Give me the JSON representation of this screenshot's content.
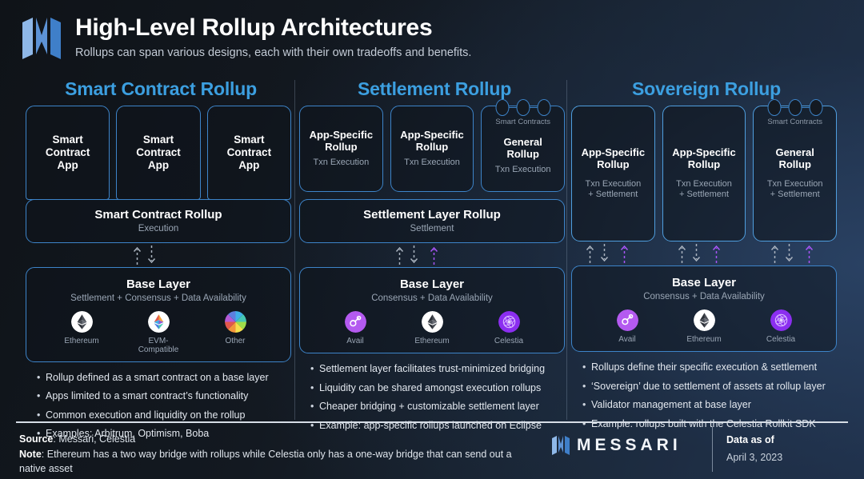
{
  "header": {
    "logo": "messari-logo",
    "title": "High-Level Rollup Architectures",
    "subtitle": "Rollups can span various designs, each with their own tradeoffs and benefits."
  },
  "colors": {
    "accent_blue": "#3c9fe0",
    "border_blue": "#3d84c9",
    "purple": "#a855f7",
    "background": "#12161c"
  },
  "columns": [
    {
      "title": "Smart Contract Rollup",
      "apps": [
        {
          "name": "Smart\nContract\nApp",
          "line1": "Smart",
          "line2": "Contract",
          "line3": "App",
          "sub": ""
        },
        {
          "name": "Smart Contract App",
          "line1": "Smart",
          "line2": "Contract",
          "line3": "App",
          "sub": ""
        },
        {
          "name": "Smart Contract App",
          "line1": "Smart",
          "line2": "Contract",
          "line3": "App",
          "sub": ""
        }
      ],
      "middle_band": {
        "title": "Smart Contract Rollup",
        "sub": "Execution"
      },
      "base_band": {
        "title": "Base Layer",
        "sub": "Settlement + Consensus + Data Availability",
        "tokens": [
          {
            "name": "Ethereum",
            "icon": "ethereum-icon"
          },
          {
            "name": "EVM-Compatible",
            "icon": "evm-compatible-icon"
          },
          {
            "name": "Other",
            "icon": "other-rainbow-icon"
          }
        ]
      },
      "bullets": [
        "Rollup defined as a smart contract on a base layer",
        "Apps limited to a smart contract’s functionality",
        "Common execution and liquidity on the rollup",
        "Examples: Arbitrum, Optimism, Boba"
      ]
    },
    {
      "title": "Settlement Rollup",
      "apps": [
        {
          "line1": "App-Specific",
          "line2": "Rollup",
          "sub": "Txn Execution",
          "bubbles": false
        },
        {
          "line1": "App-Specific",
          "line2": "Rollup",
          "sub": "Txn Execution",
          "bubbles": false
        },
        {
          "line1": "General",
          "line2": "Rollup",
          "sub": "Txn Execution",
          "bubbles": true,
          "bubble_label": "Smart Contracts"
        }
      ],
      "middle_band": {
        "title": "Settlement Layer Rollup",
        "sub": "Settlement"
      },
      "base_band": {
        "title": "Base Layer",
        "sub": "Consensus + Data Availability",
        "tokens": [
          {
            "name": "Avail",
            "icon": "avail-icon"
          },
          {
            "name": "Ethereum",
            "icon": "ethereum-icon"
          },
          {
            "name": "Celestia",
            "icon": "celestia-icon"
          }
        ]
      },
      "bullets": [
        "Settlement layer facilitates trust-minimized bridging",
        "Liquidity can be shared amongst execution rollups",
        "Cheaper bridging + customizable settlement layer",
        "Example: app-specific rollups launched on Eclipse"
      ]
    },
    {
      "title": "Sovereign Rollup",
      "apps": [
        {
          "line1": "App-Specific",
          "line2": "Rollup",
          "sub": "Txn Execution\n+ Settlement",
          "sub_a": "Txn Execution",
          "sub_b": "+ Settlement",
          "bubbles": false
        },
        {
          "line1": "App-Specific",
          "line2": "Rollup",
          "sub_a": "Txn Execution",
          "sub_b": "+ Settlement",
          "bubbles": false
        },
        {
          "line1": "General",
          "line2": "Rollup",
          "sub_a": "Txn Execution",
          "sub_b": "+ Settlement",
          "bubbles": true,
          "bubble_label": "Smart Contracts"
        }
      ],
      "base_band": {
        "title": "Base Layer",
        "sub": "Consensus + Data Availability",
        "tokens": [
          {
            "name": "Avail",
            "icon": "avail-icon"
          },
          {
            "name": "Ethereum",
            "icon": "ethereum-icon"
          },
          {
            "name": "Celestia",
            "icon": "celestia-icon"
          }
        ]
      },
      "bullets": [
        "Rollups define their specific execution & settlement",
        "‘Sovereign’ due to settlement of assets at rollup layer",
        "Validator management at base layer",
        "Example: rollups built with the Celestia Rollkit SDK"
      ]
    }
  ],
  "footer": {
    "source_label": "Source",
    "source_value": ": Messari, Celestia",
    "note_label": "Note",
    "note_value": ": Ethereum has a two way bridge with rollups while Celestia only has a one-way bridge that can send out a native asset",
    "brand": "MESSARI",
    "date_label": "Data as of",
    "date_value": "April 3, 2023"
  }
}
